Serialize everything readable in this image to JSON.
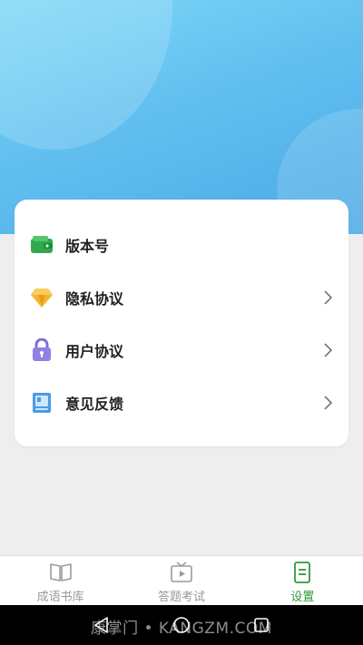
{
  "settings_menu": {
    "items": [
      {
        "label": "版本号",
        "icon": "wallet-icon",
        "has_arrow": false
      },
      {
        "label": "隐私协议",
        "icon": "diamond-icon",
        "has_arrow": true
      },
      {
        "label": "用户协议",
        "icon": "lock-icon",
        "has_arrow": true
      },
      {
        "label": "意见反馈",
        "icon": "book-icon",
        "has_arrow": true
      }
    ]
  },
  "tab_bar": {
    "tabs": [
      {
        "label": "成语书库",
        "icon": "open-book-icon",
        "active": false
      },
      {
        "label": "答题考试",
        "icon": "tv-play-icon",
        "active": false
      },
      {
        "label": "设置",
        "icon": "document-icon",
        "active": true
      }
    ],
    "active_color": "#2e9a3a",
    "inactive_color": "#9a9a9a"
  },
  "system_nav": {
    "buttons": [
      "back-icon",
      "home-icon",
      "recents-icon"
    ]
  },
  "watermark": "康掌门 • KANGZM.COM",
  "colors": {
    "header_top": "#7fd8f7",
    "header_bottom": "#4aa9e6",
    "page_bg": "#eeeeee"
  }
}
